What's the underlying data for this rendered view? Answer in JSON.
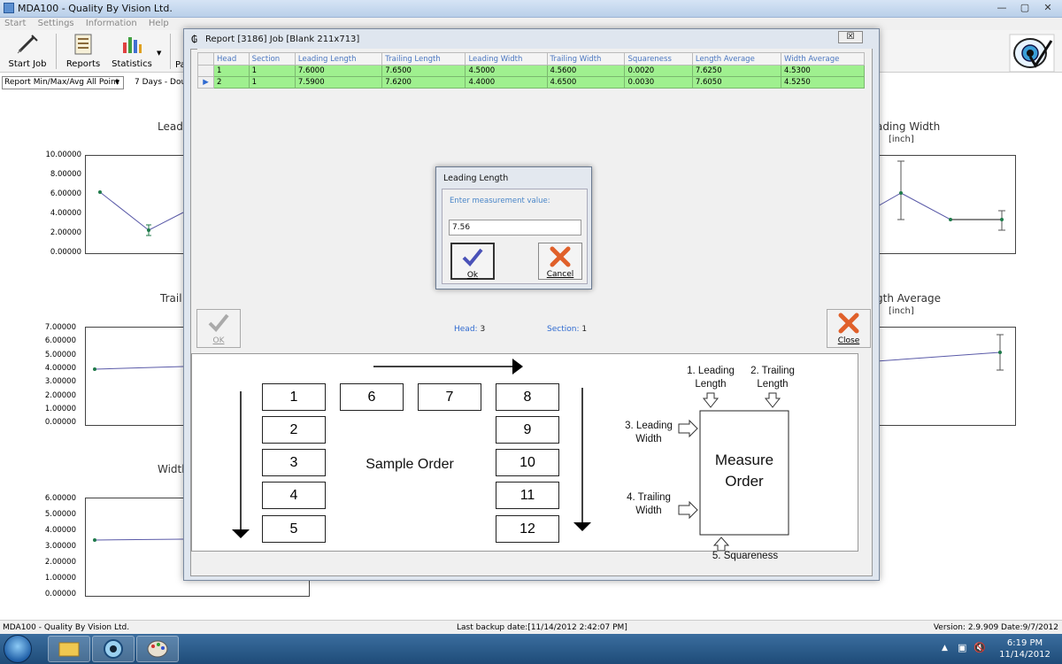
{
  "window": {
    "title": "MDA100 - Quality By Vision Ltd.",
    "menu": [
      "Start",
      "Settings",
      "Information",
      "Help"
    ],
    "controls": [
      "—",
      "▢",
      "✕"
    ]
  },
  "toolbar": {
    "start_job": "Start Job",
    "reports": "Reports",
    "statistics": "Statistics",
    "extra": "Pa"
  },
  "filter": {
    "report_select": "Report Min/Max/Avg All Point",
    "range_text": "7 Days - Dou"
  },
  "charts": [
    {
      "title": "Lead",
      "unit": "",
      "ticks": [
        "10.00000",
        "8.00000",
        "6.00000",
        "4.00000",
        "2.00000",
        "0.00000"
      ]
    },
    {
      "title": "Trail",
      "unit": "",
      "ticks": [
        "7.00000",
        "6.00000",
        "5.00000",
        "4.00000",
        "3.00000",
        "2.00000",
        "1.00000",
        "0.00000"
      ]
    },
    {
      "title": "Width",
      "unit": "",
      "ticks": [
        "6.00000",
        "5.00000",
        "4.00000",
        "3.00000",
        "2.00000",
        "1.00000",
        "0.00000"
      ]
    },
    {
      "title": "ading Width",
      "unit": "[inch]"
    },
    {
      "title": "gth Average",
      "unit": "[inch]"
    }
  ],
  "report": {
    "title": "Report [3186] Job [Blank 211x713]",
    "close_x": "☒",
    "columns": [
      "Head",
      "Section",
      "Leading Length",
      "Trailing Length",
      "Leading Width",
      "Trailing Width",
      "Squareness",
      "Length Average",
      "Width Average"
    ],
    "rows": [
      [
        "1",
        "1",
        "7.6000",
        "7.6500",
        "4.5000",
        "4.5600",
        "0.0020",
        "7.6250",
        "4.5300"
      ],
      [
        "2",
        "1",
        "7.5900",
        "7.6200",
        "4.4000",
        "4.6500",
        "0.0030",
        "7.6050",
        "4.5250"
      ]
    ],
    "ok_label": "OK",
    "close_label": "Close",
    "head_label": "Head:",
    "head_value": "3",
    "section_label": "Section:",
    "section_value": "1"
  },
  "diagram": {
    "sample_order": "Sample Order",
    "measure_order": "Measure Order",
    "left_boxes": [
      "1",
      "2",
      "3",
      "4",
      "5"
    ],
    "top_boxes": [
      "6",
      "7"
    ],
    "right_boxes": [
      "8",
      "9",
      "10",
      "11",
      "12"
    ],
    "m1": "1. Leading Length",
    "m2": "2. Trailing Length",
    "m3": "3. Leading Width",
    "m4": "4. Trailing Width",
    "m5": "5. Squareness"
  },
  "modal": {
    "title": "Leading Length",
    "prompt": "Enter measurement value:",
    "value": "7.56",
    "ok": "Ok",
    "cancel": "Cancel"
  },
  "status": {
    "left": "MDA100 - Quality By Vision Ltd.",
    "backup": "Last backup date:[11/14/2012 2:42:07 PM]",
    "version": "Version: 2.9.909  Date:9/7/2012"
  },
  "taskbar": {
    "time": "6:19 PM",
    "date": "11/14/2012"
  }
}
